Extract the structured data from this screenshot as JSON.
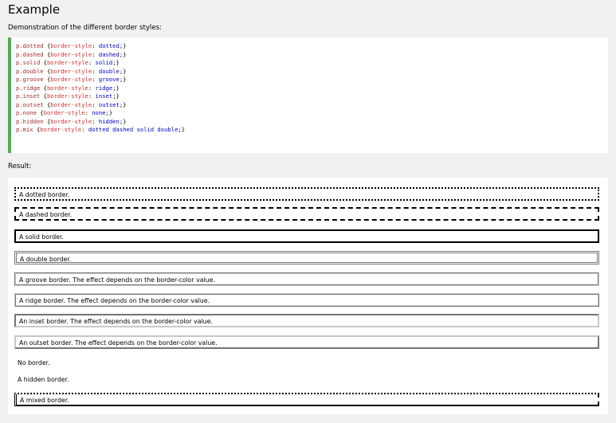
{
  "heading": "Example",
  "intro": "Demonstration of the different border styles:",
  "code": [
    {
      "selector": "p.dotted",
      "property": "border-style",
      "value": "dotted"
    },
    {
      "selector": "p.dashed",
      "property": "border-style",
      "value": "dashed"
    },
    {
      "selector": "p.solid",
      "property": "border-style",
      "value": "solid"
    },
    {
      "selector": "p.double",
      "property": "border-style",
      "value": "double"
    },
    {
      "selector": "p.groove",
      "property": "border-style",
      "value": "groove"
    },
    {
      "selector": "p.ridge",
      "property": "border-style",
      "value": "ridge"
    },
    {
      "selector": "p.inset",
      "property": "border-style",
      "value": "inset"
    },
    {
      "selector": "p.outset",
      "property": "border-style",
      "value": "outset"
    },
    {
      "selector": "p.none",
      "property": "border-style",
      "value": "none"
    },
    {
      "selector": "p.hidden",
      "property": "border-style",
      "value": "hidden"
    },
    {
      "selector": "p.mix",
      "property": "border-style",
      "value": "dotted dashed solid double"
    }
  ],
  "result_label": "Result:",
  "results": [
    {
      "text": "A dotted border."
    },
    {
      "text": "A dashed border."
    },
    {
      "text": "A solid border."
    },
    {
      "text": "A double border."
    },
    {
      "text": "A groove border. The effect depends on the border-color value."
    },
    {
      "text": "A ridge border. The effect depends on the border-color value."
    },
    {
      "text": "An inset border. The effect depends on the border-color value."
    },
    {
      "text": "An outset border. The effect depends on the border-color value."
    },
    {
      "text": "No border."
    },
    {
      "text": "A hidden border."
    },
    {
      "text": "A mixed border."
    }
  ],
  "colors": {
    "accent": "#4caf50",
    "selector": "#a52a2a",
    "property": "#d0312d",
    "value": "#0000cd"
  }
}
